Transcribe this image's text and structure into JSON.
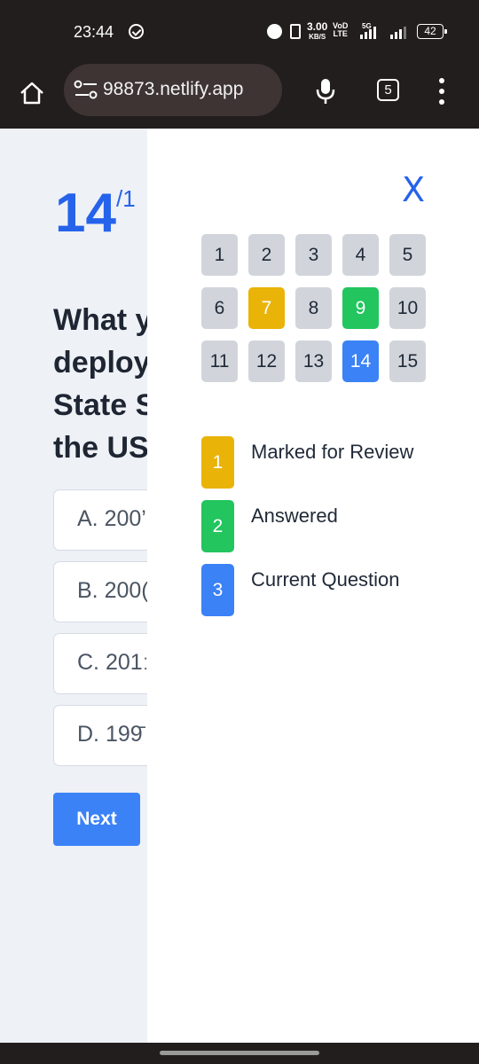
{
  "status_bar": {
    "time": "23:44",
    "net_speed_value": "3.00",
    "net_speed_unit": "KB/S",
    "volte_top": "VoD",
    "volte_bottom": "LTE",
    "network_type": "5G",
    "battery": "42",
    "icons": [
      "check-circle-icon",
      "alarm-icon",
      "vibrate-icon",
      "signal-icon",
      "battery-icon"
    ]
  },
  "browser": {
    "url": "98873.netlify.app",
    "tab_count": "5",
    "icons": [
      "home-icon",
      "site-settings-icon",
      "mic-icon",
      "tabs-icon",
      "menu-icon"
    ]
  },
  "quiz": {
    "question_number": "14",
    "question_total_fragment": "/1",
    "question_text_lines": [
      "What y",
      "deploy",
      "State S",
      "the US"
    ],
    "options": [
      {
        "label": "A. 200’"
      },
      {
        "label": "B. 200("
      },
      {
        "label": "C. 201ː"
      },
      {
        "label": "D. 199̄"
      }
    ],
    "next_label": "Next"
  },
  "panel": {
    "close_label": "X",
    "question_buttons": [
      {
        "label": "1",
        "state": "default"
      },
      {
        "label": "2",
        "state": "default"
      },
      {
        "label": "3",
        "state": "default"
      },
      {
        "label": "4",
        "state": "default"
      },
      {
        "label": "5",
        "state": "default"
      },
      {
        "label": "6",
        "state": "default"
      },
      {
        "label": "7",
        "state": "review"
      },
      {
        "label": "8",
        "state": "default"
      },
      {
        "label": "9",
        "state": "answered"
      },
      {
        "label": "10",
        "state": "default"
      },
      {
        "label": "11",
        "state": "default"
      },
      {
        "label": "12",
        "state": "default"
      },
      {
        "label": "13",
        "state": "default"
      },
      {
        "label": "14",
        "state": "current"
      },
      {
        "label": "15",
        "state": "default"
      }
    ],
    "legend": [
      {
        "swatch": "1",
        "label": "Marked for Review",
        "color": "#eab308"
      },
      {
        "swatch": "2",
        "label": "Answered",
        "color": "#22c55e"
      },
      {
        "swatch": "3",
        "label": "Current Question",
        "color": "#3b82f6"
      }
    ]
  },
  "colors": {
    "accent_blue": "#2563eb",
    "review_yellow": "#eab308",
    "answered_green": "#22c55e",
    "current_blue": "#3b82f6",
    "default_gray": "#d1d5db"
  }
}
